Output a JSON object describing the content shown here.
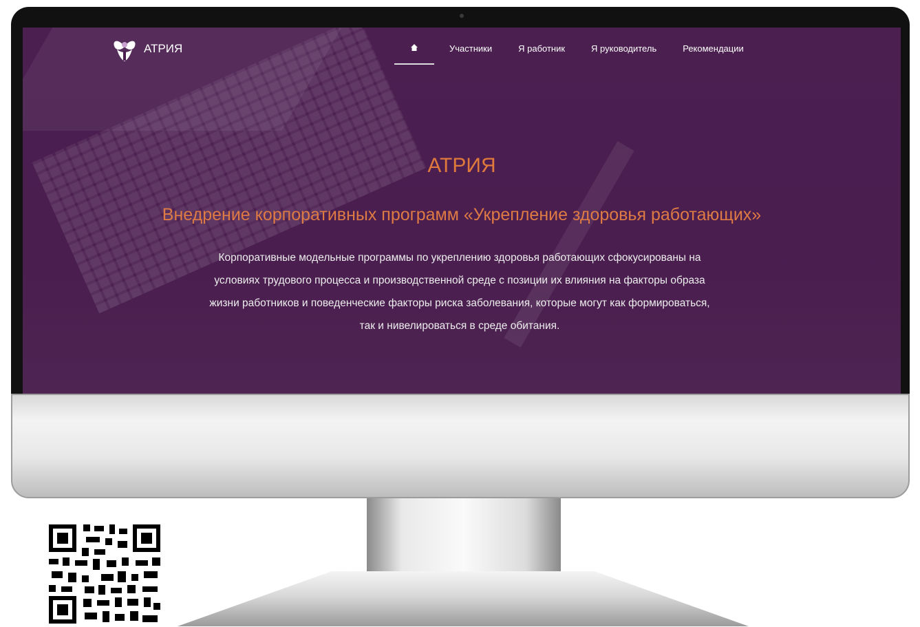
{
  "site": {
    "brand": "АТРИЯ",
    "nav": [
      "Участники",
      "Я работник",
      "Я руководитель",
      "Рекомендации"
    ]
  },
  "hero": {
    "title": "АТРИЯ",
    "subtitle": "Внедрение корпоративных программ «Укрепление здоровья работающих»",
    "description": "Корпоративные модельные программы по укреплению здоровья работающих сфокусированы на условиях трудового процесса и производственной среде с позиции их влияния на факторы образа жизни работников и поведенческие факторы риска заболевания, которые могут как формироваться, так и нивелироваться в среде обитания."
  },
  "colors": {
    "hero_bg": "#4b1f50",
    "accent": "#e07a3c"
  }
}
